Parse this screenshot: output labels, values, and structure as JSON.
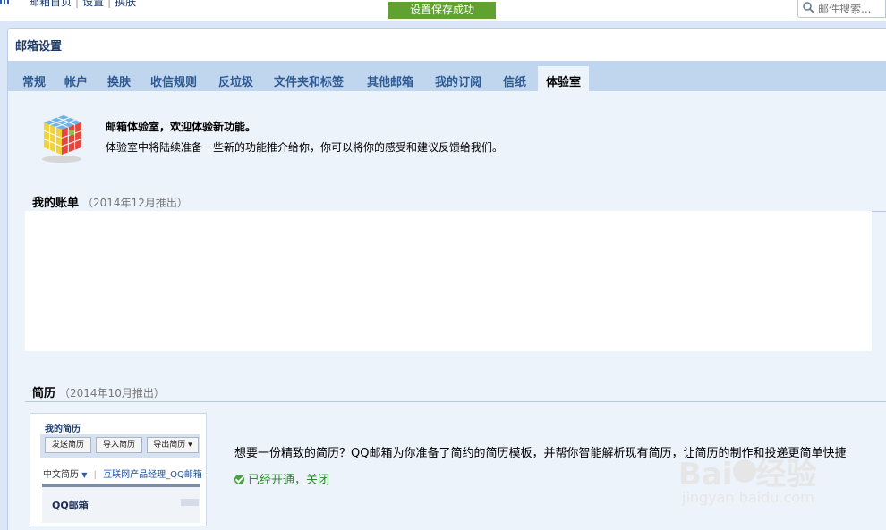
{
  "topbar": {
    "links": [
      "邮箱首页",
      "设置",
      "换肤"
    ],
    "separator": "|",
    "toast": "设置保存成功",
    "search_placeholder": "邮件搜索..."
  },
  "panel": {
    "title": "邮箱设置",
    "tabs": [
      {
        "label": "常规"
      },
      {
        "label": "帐户"
      },
      {
        "label": "换肤"
      },
      {
        "label": "收信规则"
      },
      {
        "label": "反垃圾"
      },
      {
        "label": "文件夹和标签"
      },
      {
        "label": "其他邮箱"
      },
      {
        "label": "我的订阅"
      },
      {
        "label": "信纸"
      },
      {
        "label": "体验室",
        "active": true
      }
    ]
  },
  "lab": {
    "title": "邮箱体验室，欢迎体验新功能。",
    "desc": "体验室中将陆续准备一些新的功能推介给你，你可以将你的感受和建议反馈给我们。"
  },
  "bill": {
    "title": "我的账单",
    "date": "（2014年12月推出）"
  },
  "resume": {
    "title": "简历",
    "date": "（2014年10月推出）",
    "desc": "想要一份精致的简历？QQ邮箱为你准备了简约的简历模板，并帮你智能解析现有简历，让简历的制作和投递更简单快捷",
    "status": "已经开通，",
    "close_label": "关闭",
    "thumb": {
      "title": "我的简历",
      "buttons": [
        "发送简历",
        "导入简历",
        "导出简历 ▾"
      ],
      "lang": "中文简历",
      "divider": "|",
      "resume_name": "互联网产品经理_QQ邮箱",
      "brand": "QQ邮箱"
    }
  },
  "watermark": {
    "main_a": "Bai",
    "main_b": "经验",
    "sub": "jingyan.baidu.com"
  },
  "colors": {
    "toast_bg": "#5fa22f",
    "tab_bar": "#c0d6ef",
    "content_bg": "#edf3fb",
    "link": "#2e5a93",
    "status_green": "#2f8a2f"
  }
}
